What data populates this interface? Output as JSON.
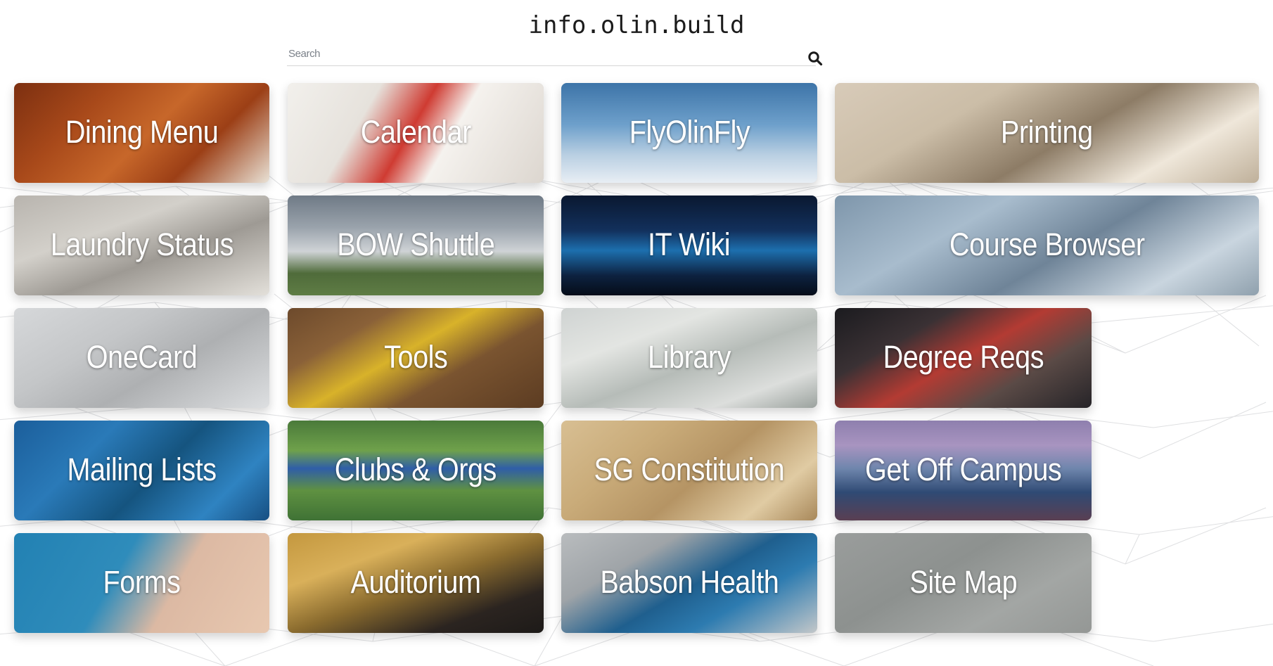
{
  "header": {
    "title": "info.olin.build"
  },
  "search": {
    "placeholder": "Search",
    "value": "",
    "icon": "search-icon",
    "icon_label": "Search"
  },
  "grid": {
    "columns": 4,
    "rows": 5,
    "tiles": [
      {
        "label": "Dining Menu",
        "image": "bowl of chili with cilantro garnish",
        "gradient": "linear-gradient(135deg,#7c2f10 0%,#a8491a 28%,#c7672a 52%,#9c3f16 72%,#e9e2d6 100%)"
      },
      {
        "label": "Calendar",
        "image": "desk calendar pages with dates",
        "gradient": "linear-gradient(120deg,#f2f0ec 0%,#e6e2dc 30%,#cf3b32 48%,#f5f2ee 62%,#dcd6cf 100%)"
      },
      {
        "label": "FlyOlinFly",
        "image": "airplane flying above clouds",
        "gradient": "linear-gradient(180deg,#3d74a8 0%,#6ea0cb 42%,#b9cfe2 72%,#e8eef4 100%)"
      },
      {
        "label": "Printing",
        "image": "office copier printer with paper",
        "gradient": "linear-gradient(150deg,#d8cbb9 0%,#cbbda7 30%,#8d7c66 55%,#efe7da 78%,#bfb09a 100%)"
      },
      {
        "label": "Laundry Status",
        "image": "row of washing machines",
        "gradient": "linear-gradient(160deg,#b8b4ae 0%,#d3d0ca 35%,#9e9a94 60%,#e3e0da 100%)"
      },
      {
        "label": "BOW Shuttle",
        "image": "white shuttle van with city skyline",
        "gradient": "linear-gradient(180deg,#6f7a86 0%,#9aa3ac 32%,#cfd3d6 56%,#4f6b3a 78%,#5f7d45 100%)"
      },
      {
        "label": "IT Wiki",
        "image": "data center server racks aisle",
        "gradient": "linear-gradient(180deg,#0a1830 0%,#12305c 35%,#1d6fae 55%,#0d2240 80%,#050c18 100%)"
      },
      {
        "label": "Course Browser",
        "image": "Olin academic center building",
        "gradient": "linear-gradient(150deg,#7e96ab 0%,#a8bccd 30%,#6f8498 55%,#c9d5df 80%,#8fa0ad 100%)"
      },
      {
        "label": "OneCard",
        "image": "jar of coins spilled on table",
        "gradient": "linear-gradient(150deg,#d6d8da 0%,#c4c6c8 35%,#aeb0b2 60%,#dddfe1 100%)"
      },
      {
        "label": "Tools",
        "image": "hand tools laid on wood bench",
        "gradient": "linear-gradient(150deg,#6d4a2c 0%,#8a6138 25%,#d8b22a 45%,#7a5430 65%,#5c3c22 100%)"
      },
      {
        "label": "Library",
        "image": "library reading room interior",
        "gradient": "linear-gradient(160deg,#cfd3d2 0%,#e3e5e2 30%,#b6bcb8 55%,#dcdedc 80%,#9ba29e 100%)"
      },
      {
        "label": "Degree Reqs",
        "image": "graduates in caps and gowns",
        "gradient": "linear-gradient(150deg,#1b1b1f 0%,#3a3134 28%,#b33b33 50%,#5a4a46 72%,#262428 100%)"
      },
      {
        "label": "Mailing Lists",
        "image": "envelopes mail icons pattern blue",
        "gradient": "linear-gradient(135deg,#1b5e9b 0%,#2a7ab8 30%,#15547f 55%,#2f83c1 80%,#174f82 100%)"
      },
      {
        "label": "Clubs & Orgs",
        "image": "soccer players on green field",
        "gradient": "linear-gradient(180deg,#4a7a3a 0%,#6fa14b 30%,#2f5ea8 48%,#5f9141 70%,#3f7235 100%)"
      },
      {
        "label": "SG Constitution",
        "image": "US Constitution We the People parchment",
        "gradient": "linear-gradient(140deg,#d8bf93 0%,#c9ab79 30%,#b59464 55%,#e0cba3 80%,#a8885a 100%)"
      },
      {
        "label": "Get Off Campus",
        "image": "Boston skyline at dusk",
        "gradient": "linear-gradient(180deg,#8e7fae 0%,#a894c0 25%,#6f86ad 48%,#2f4a74 72%,#5a3f52 100%)"
      },
      {
        "label": "Forms",
        "image": "hand writing with pen on paper",
        "gradient": "linear-gradient(120deg,#2281b3 0%,#2f8cbb 40%,#dcb9a3 62%,#e8c8b0 100%)"
      },
      {
        "label": "Auditorium",
        "image": "wood paneled auditorium seating",
        "gradient": "linear-gradient(160deg,#c4983f 0%,#d9b05a 28%,#8a6b2e 52%,#2b2420 78%,#1d1a18 100%)"
      },
      {
        "label": "Babson Health",
        "image": "stethoscope on gray surface",
        "gradient": "linear-gradient(150deg,#b9bcbe 0%,#9fa4a8 28%,#1f5f8e 52%,#2d7bb0 70%,#c3c7c9 100%)"
      },
      {
        "label": "Site Map",
        "image": "blue circular arrow site logo",
        "gradient": "linear-gradient(150deg,#9a9d9c 0%,#8d918f 40%,#a3a6a4 70%,#949795 100%)"
      }
    ]
  }
}
